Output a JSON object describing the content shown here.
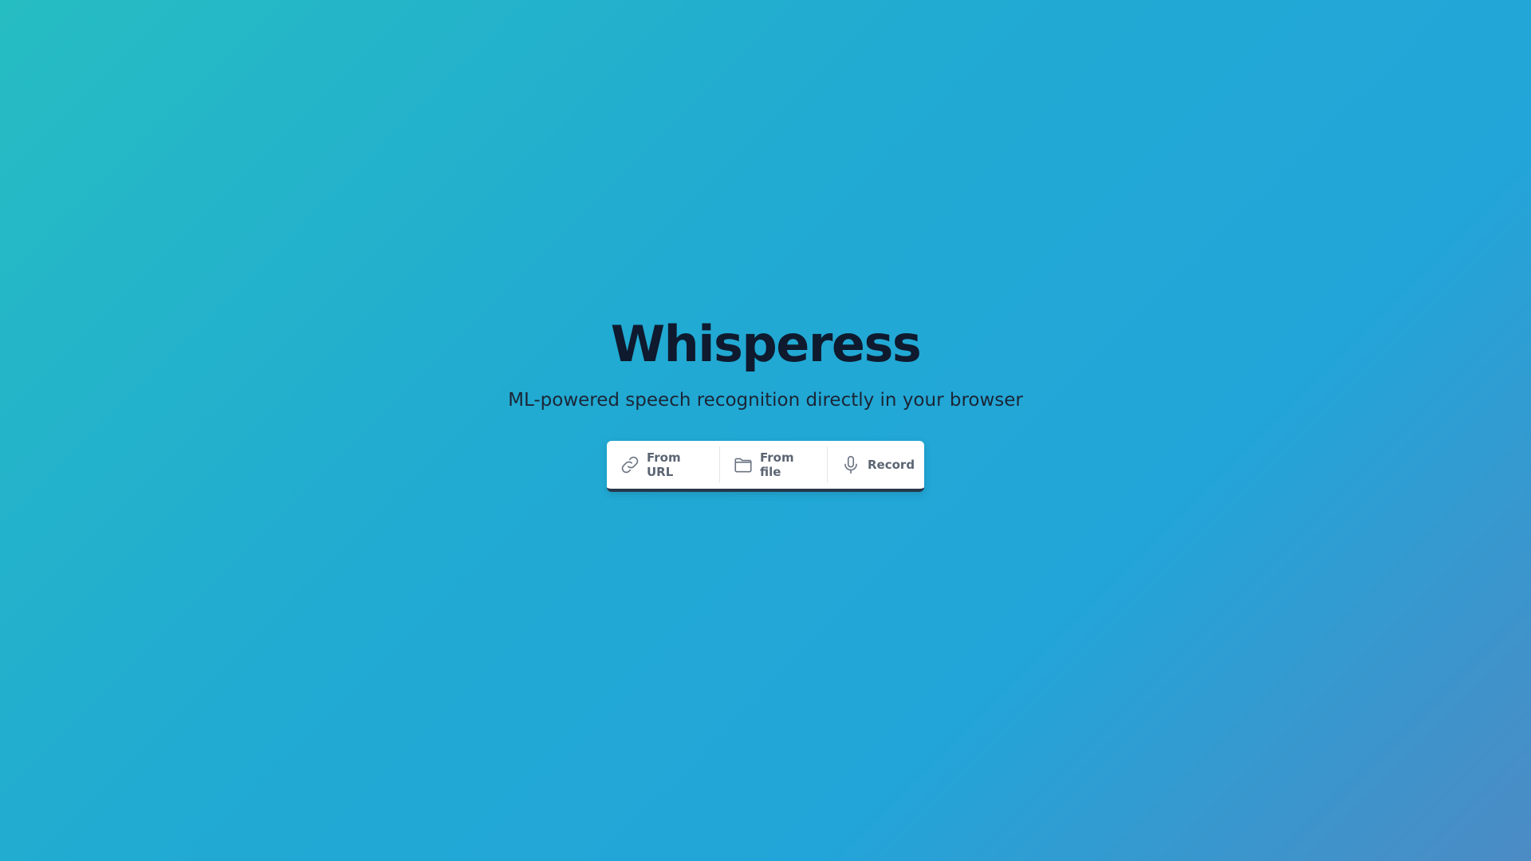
{
  "app": {
    "title": "Whisperess",
    "subtitle": "ML-powered speech recognition directly in your browser"
  },
  "toolbar": {
    "buttons": [
      {
        "label": "From URL",
        "icon": "link-icon"
      },
      {
        "label": "From file",
        "icon": "folder-icon"
      },
      {
        "label": "Record",
        "icon": "microphone-icon"
      }
    ]
  },
  "colors": {
    "gradient_start": "#26bdc2",
    "gradient_end": "#4c8bc4",
    "title_color": "#0f1a2e",
    "toolbar_bg": "#ffffff",
    "toolbar_border": "#27384a"
  }
}
